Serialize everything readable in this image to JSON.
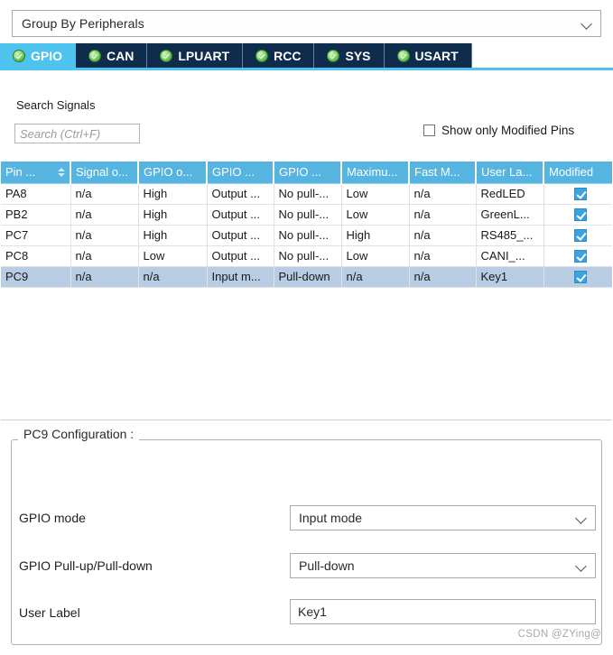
{
  "group_combo": {
    "value": "Group By Peripherals",
    "chevron_icon": "chevron-down-icon"
  },
  "tabs": [
    {
      "label": "GPIO",
      "active": true,
      "status_icon": "green-check-icon"
    },
    {
      "label": "CAN",
      "active": false,
      "status_icon": "green-check-icon"
    },
    {
      "label": "LPUART",
      "active": false,
      "status_icon": "green-check-icon"
    },
    {
      "label": "RCC",
      "active": false,
      "status_icon": "green-check-icon"
    },
    {
      "label": "SYS",
      "active": false,
      "status_icon": "green-check-icon"
    },
    {
      "label": "USART",
      "active": false,
      "status_icon": "green-check-icon"
    }
  ],
  "search": {
    "label": "Search Signals",
    "value": "",
    "placeholder": "Search (Ctrl+F)"
  },
  "filters": {
    "show_only_modified_label": "Show only Modified Pins",
    "show_only_modified_checked": false
  },
  "table": {
    "columns": [
      {
        "label": "Pin ...",
        "sortable": true
      },
      {
        "label": "Signal o...",
        "sortable": false
      },
      {
        "label": "GPIO o...",
        "sortable": false
      },
      {
        "label": "GPIO ...",
        "sortable": false
      },
      {
        "label": "GPIO ...",
        "sortable": false
      },
      {
        "label": "Maximu...",
        "sortable": false
      },
      {
        "label": "Fast M...",
        "sortable": false
      },
      {
        "label": "User La...",
        "sortable": false
      },
      {
        "label": "Modified",
        "sortable": false
      }
    ],
    "rows": [
      {
        "pin": "PA8",
        "signal": "n/a",
        "gpio_output": "High",
        "gpio_mode": "Output ...",
        "gpio_pull": "No pull-...",
        "maximum": "Low",
        "fast_mode": "n/a",
        "user_label": "RedLED",
        "modified": true,
        "selected": false
      },
      {
        "pin": "PB2",
        "signal": "n/a",
        "gpio_output": "High",
        "gpio_mode": "Output ...",
        "gpio_pull": "No pull-...",
        "maximum": "Low",
        "fast_mode": "n/a",
        "user_label": "GreenL...",
        "modified": true,
        "selected": false
      },
      {
        "pin": "PC7",
        "signal": "n/a",
        "gpio_output": "High",
        "gpio_mode": "Output ...",
        "gpio_pull": "No pull-...",
        "maximum": "High",
        "fast_mode": "n/a",
        "user_label": "RS485_...",
        "modified": true,
        "selected": false
      },
      {
        "pin": "PC8",
        "signal": "n/a",
        "gpio_output": "Low",
        "gpio_mode": "Output ...",
        "gpio_pull": "No pull-...",
        "maximum": "Low",
        "fast_mode": "n/a",
        "user_label": "CANI_...",
        "modified": true,
        "selected": false
      },
      {
        "pin": "PC9",
        "signal": "n/a",
        "gpio_output": "n/a",
        "gpio_mode": "Input m...",
        "gpio_pull": "Pull-down",
        "maximum": "n/a",
        "fast_mode": "n/a",
        "user_label": "Key1",
        "modified": true,
        "selected": true
      }
    ]
  },
  "configuration": {
    "legend": "PC9 Configuration :",
    "gpio_mode": {
      "label": "GPIO mode",
      "value": "Input mode"
    },
    "gpio_pull": {
      "label": "GPIO Pull-up/Pull-down",
      "value": "Pull-down"
    },
    "user_label": {
      "label": "User Label",
      "value": "Key1"
    }
  },
  "watermark": "CSDN @ZYing@",
  "colors": {
    "accent_blue": "#4ec3ee",
    "header_blue": "#55b4e0",
    "tab_dark": "#0f2c4c",
    "selection": "#b8cce4",
    "check_green": "#2f9b2f",
    "checkbox_blue": "#3ba3df"
  }
}
